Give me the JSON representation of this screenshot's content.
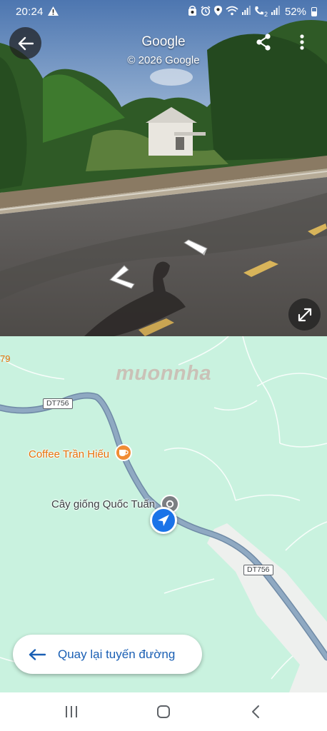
{
  "status_bar": {
    "time": "20:24",
    "battery": "52%",
    "network": "2"
  },
  "street_view": {
    "title": "Google",
    "copyright": "© 2026 Google",
    "icons": [
      "back-arrow-icon",
      "share-icon",
      "more-vert-icon",
      "expand-icon"
    ]
  },
  "map": {
    "edge_label": "79",
    "road_name_1": "DT756",
    "road_name_2": "DT756",
    "poi_coffee": "Coffee Trần Hiếu",
    "poi_nursery": "Cây giống Quốc Tuấn",
    "watermark": "muonnha",
    "colors": {
      "land": "#c9f2df",
      "road": "#8aa3bc",
      "accent": "#1a73e8",
      "poi_orange": "#f08c34"
    }
  },
  "route_button": {
    "label": "Quay lại tuyến đường"
  },
  "nav_bar": {
    "icons": [
      "recent-apps-icon",
      "home-icon",
      "back-icon"
    ]
  }
}
